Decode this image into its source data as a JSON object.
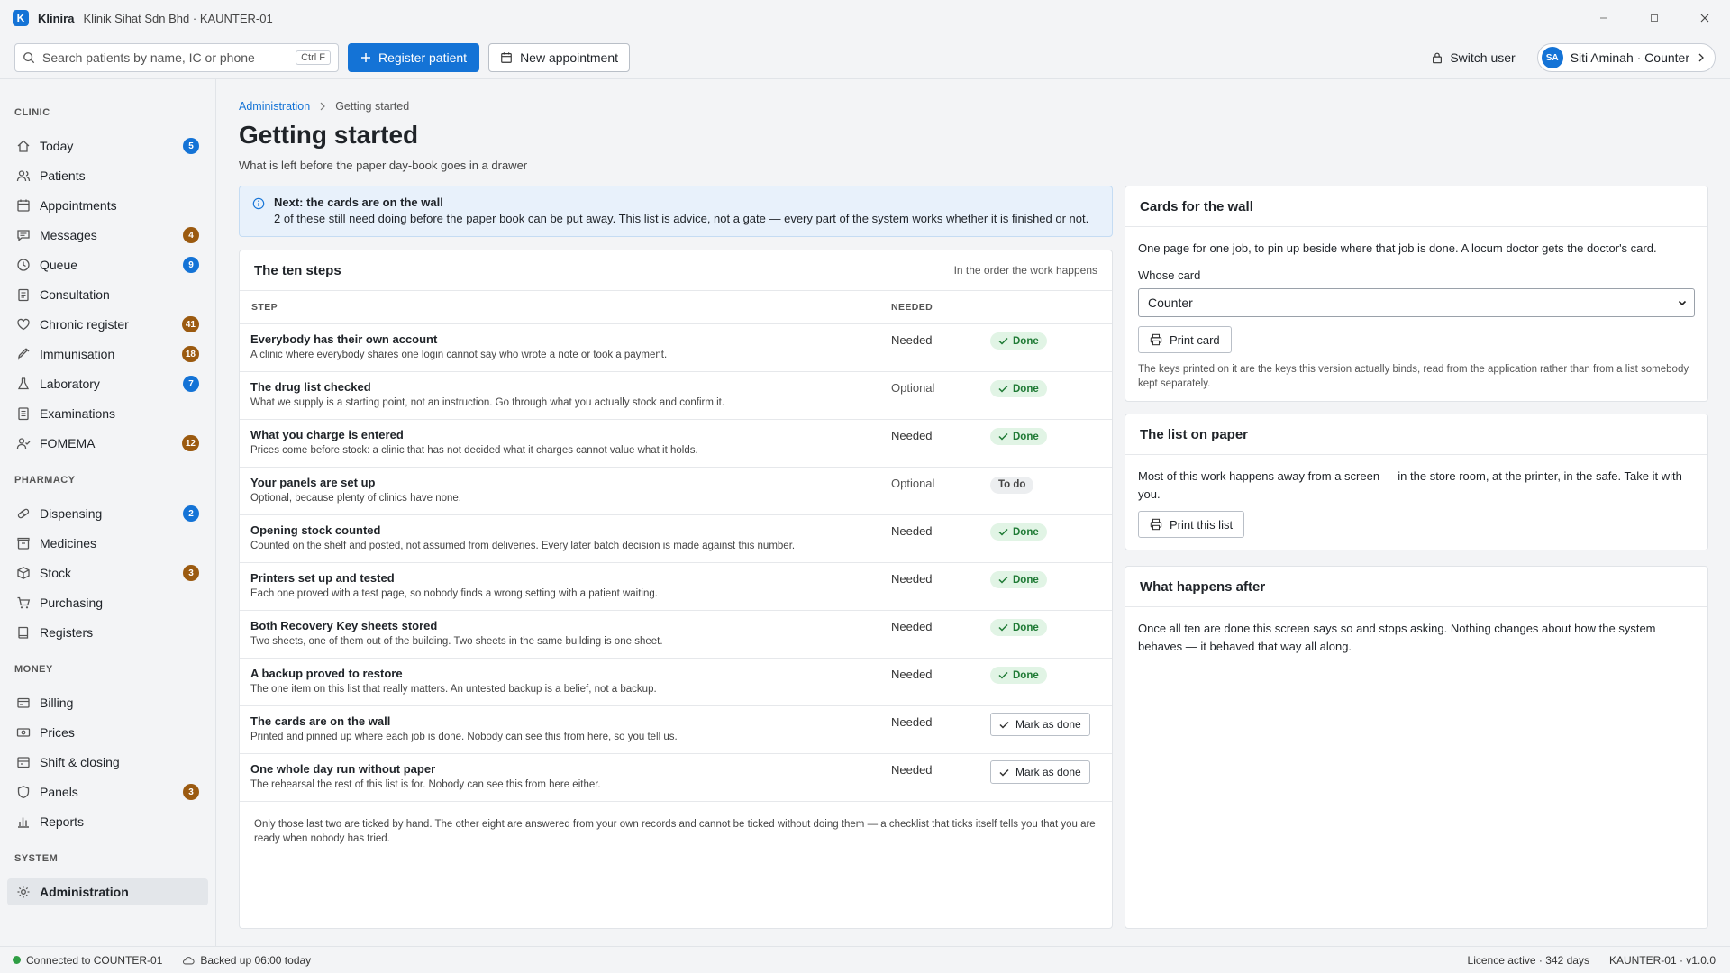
{
  "app": {
    "logo_letter": "K",
    "name": "Klinira",
    "subtitle": "Klinik Sihat Sdn Bhd · KAUNTER-01"
  },
  "toolbar": {
    "search_placeholder": "Search patients by name, IC or phone",
    "search_shortcut": "Ctrl F",
    "register_label": "Register patient",
    "appointment_label": "New appointment",
    "switch_user_label": "Switch user",
    "user_initials": "SA",
    "user_label": "Siti Aminah · Counter"
  },
  "sidebar": {
    "sections": [
      {
        "title": "CLINIC",
        "items": [
          {
            "label": "Today",
            "icon": "home-icon",
            "badge": "5",
            "badge_color": "blue"
          },
          {
            "label": "Patients",
            "icon": "users-icon",
            "badge": "",
            "badge_color": ""
          },
          {
            "label": "Appointments",
            "icon": "calendar-icon",
            "badge": "",
            "badge_color": ""
          },
          {
            "label": "Messages",
            "icon": "message-icon",
            "badge": "4",
            "badge_color": "brown"
          },
          {
            "label": "Queue",
            "icon": "clock-icon",
            "badge": "9",
            "badge_color": "blue"
          },
          {
            "label": "Consultation",
            "icon": "clipboard-icon",
            "badge": "",
            "badge_color": ""
          },
          {
            "label": "Chronic register",
            "icon": "heart-icon",
            "badge": "41",
            "badge_color": "brown"
          },
          {
            "label": "Immunisation",
            "icon": "syringe-icon",
            "badge": "18",
            "badge_color": "brown"
          },
          {
            "label": "Laboratory",
            "icon": "flask-icon",
            "badge": "7",
            "badge_color": "blue"
          },
          {
            "label": "Examinations",
            "icon": "document-icon",
            "badge": "",
            "badge_color": ""
          },
          {
            "label": "FOMEMA",
            "icon": "person-check-icon",
            "badge": "12",
            "badge_color": "brown"
          }
        ]
      },
      {
        "title": "PHARMACY",
        "items": [
          {
            "label": "Dispensing",
            "icon": "pill-icon",
            "badge": "2",
            "badge_color": "blue"
          },
          {
            "label": "Medicines",
            "icon": "box-icon",
            "badge": "",
            "badge_color": ""
          },
          {
            "label": "Stock",
            "icon": "package-icon",
            "badge": "3",
            "badge_color": "brown"
          },
          {
            "label": "Purchasing",
            "icon": "cart-icon",
            "badge": "",
            "badge_color": ""
          },
          {
            "label": "Registers",
            "icon": "book-icon",
            "badge": "",
            "badge_color": ""
          }
        ]
      },
      {
        "title": "MONEY",
        "items": [
          {
            "label": "Billing",
            "icon": "wallet-icon",
            "badge": "",
            "badge_color": ""
          },
          {
            "label": "Prices",
            "icon": "tag-icon",
            "badge": "",
            "badge_color": ""
          },
          {
            "label": "Shift & closing",
            "icon": "cash-icon",
            "badge": "",
            "badge_color": ""
          },
          {
            "label": "Panels",
            "icon": "shield-icon",
            "badge": "3",
            "badge_color": "brown"
          },
          {
            "label": "Reports",
            "icon": "bar-chart-icon",
            "badge": "",
            "badge_color": ""
          }
        ]
      },
      {
        "title": "SYSTEM",
        "items": [
          {
            "label": "Administration",
            "icon": "gear-icon",
            "badge": "",
            "badge_color": "",
            "active": true
          }
        ]
      }
    ]
  },
  "page": {
    "breadcrumb_parent": "Administration",
    "breadcrumb_current": "Getting started",
    "title": "Getting started",
    "subtitle": "What is left before the paper day-book goes in a drawer"
  },
  "banner": {
    "title": "Next: the cards are on the wall",
    "text": "2 of these still need doing before the paper book can be put away. This list is advice, not a gate — every part of the system works whether it is finished or not."
  },
  "steps": {
    "title": "The ten steps",
    "subtitle": "In the order the work happens",
    "col_step": "STEP",
    "col_needed": "NEEDED",
    "rows": [
      {
        "name": "Everybody has their own account",
        "desc": "A clinic where everybody shares one login cannot say who wrote a note or took a payment.",
        "needed": "Needed",
        "status": "done",
        "status_label": "Done"
      },
      {
        "name": "The drug list checked",
        "desc": "What we supply is a starting point, not an instruction. Go through what you actually stock and confirm it.",
        "needed": "Optional",
        "status": "done",
        "status_label": "Done"
      },
      {
        "name": "What you charge is entered",
        "desc": "Prices come before stock: a clinic that has not decided what it charges cannot value what it holds.",
        "needed": "Needed",
        "status": "done",
        "status_label": "Done"
      },
      {
        "name": "Your panels are set up",
        "desc": "Optional, because plenty of clinics have none.",
        "needed": "Optional",
        "status": "todo",
        "status_label": "To do"
      },
      {
        "name": "Opening stock counted",
        "desc": "Counted on the shelf and posted, not assumed from deliveries. Every later batch decision is made against this number.",
        "needed": "Needed",
        "status": "done",
        "status_label": "Done"
      },
      {
        "name": "Printers set up and tested",
        "desc": "Each one proved with a test page, so nobody finds a wrong setting with a patient waiting.",
        "needed": "Needed",
        "status": "done",
        "status_label": "Done"
      },
      {
        "name": "Both Recovery Key sheets stored",
        "desc": "Two sheets, one of them out of the building. Two sheets in the same building is one sheet.",
        "needed": "Needed",
        "status": "done",
        "status_label": "Done"
      },
      {
        "name": "A backup proved to restore",
        "desc": "The one item on this list that really matters. An untested backup is a belief, not a backup.",
        "needed": "Needed",
        "status": "done",
        "status_label": "Done"
      },
      {
        "name": "The cards are on the wall",
        "desc": "Printed and pinned up where each job is done. Nobody can see this from here, so you tell us.",
        "needed": "Needed",
        "status": "mark",
        "status_label": "Mark as done"
      },
      {
        "name": "One whole day run without paper",
        "desc": "The rehearsal the rest of this list is for. Nobody can see this from here either.",
        "needed": "Needed",
        "status": "mark",
        "status_label": "Mark as done"
      }
    ],
    "footer": "Only those last two are ticked by hand. The other eight are answered from your own records and cannot be ticked without doing them — a checklist that ticks itself tells you that you are ready when nobody has tried."
  },
  "cards_panel": {
    "title": "Cards for the wall",
    "text": "One page for one job, to pin up beside where that job is done. A locum doctor gets the doctor's card.",
    "field_label": "Whose card",
    "selected": "Counter",
    "print_label": "Print card",
    "note": "The keys printed on it are the keys this version actually binds, read from the application rather than from a list somebody kept separately."
  },
  "paper_panel": {
    "title": "The list on paper",
    "text": "Most of this work happens away from a screen — in the store room, at the printer, in the safe. Take it with you.",
    "print_label": "Print this list"
  },
  "after_panel": {
    "title": "What happens after",
    "text": "Once all ten are done this screen says so and stops asking. Nothing changes about how the system behaves — it behaved that way all along."
  },
  "statusbar": {
    "connected": "Connected to COUNTER-01",
    "backup": "Backed up 06:00 today",
    "licence": "Licence active · 342 days",
    "version": "KAUNTER-01 · v1.0.0"
  },
  "colors": {
    "accent": "#1473d6",
    "badge_brown": "#9b5a10",
    "done_green": "#1f7a35",
    "banner_bg": "#e8f1fb"
  }
}
